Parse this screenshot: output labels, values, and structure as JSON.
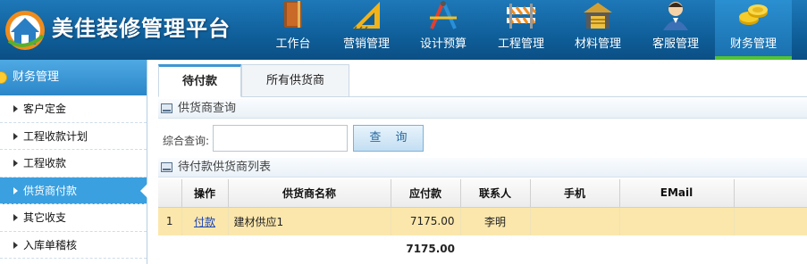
{
  "app": {
    "title": "美佳装修管理平台"
  },
  "nav": {
    "items": [
      {
        "label": "工作台",
        "icon": "book-icon"
      },
      {
        "label": "营销管理",
        "icon": "ruler-icon"
      },
      {
        "label": "设计预算",
        "icon": "design-tools-icon"
      },
      {
        "label": "工程管理",
        "icon": "barrier-icon"
      },
      {
        "label": "材料管理",
        "icon": "warehouse-icon"
      },
      {
        "label": "客服管理",
        "icon": "customer-service-icon"
      },
      {
        "label": "财务管理",
        "icon": "coins-icon",
        "active": true
      }
    ]
  },
  "sidebar": {
    "title": "财务管理",
    "items": [
      {
        "label": "客户定金"
      },
      {
        "label": "工程收款计划"
      },
      {
        "label": "工程收款"
      },
      {
        "label": "供货商付款",
        "active": true
      },
      {
        "label": "其它收支"
      },
      {
        "label": "入库单稽核"
      }
    ]
  },
  "tabs": [
    {
      "label": "待付款",
      "active": true
    },
    {
      "label": "所有供货商"
    }
  ],
  "search_section": {
    "title": "供货商查询"
  },
  "query": {
    "label": "综合查询:",
    "value": "",
    "placeholder": "",
    "button": "查 询"
  },
  "list_section": {
    "title": "待付款供货商列表"
  },
  "table": {
    "columns": [
      "",
      "操作",
      "供货商名称",
      "应付款",
      "联系人",
      "手机",
      "EMail"
    ],
    "rows": [
      {
        "index": "1",
        "action": "付款",
        "name": "建材供应1",
        "amount": "7175.00",
        "contact": "李明",
        "phone": "",
        "email": ""
      }
    ],
    "total": "7175.00"
  },
  "colors": {
    "header": "#1a6fae",
    "active_nav_bar": "#52c234",
    "row_highlight": "#fbe7ac",
    "sidebar_active": "#3aa0e0"
  }
}
